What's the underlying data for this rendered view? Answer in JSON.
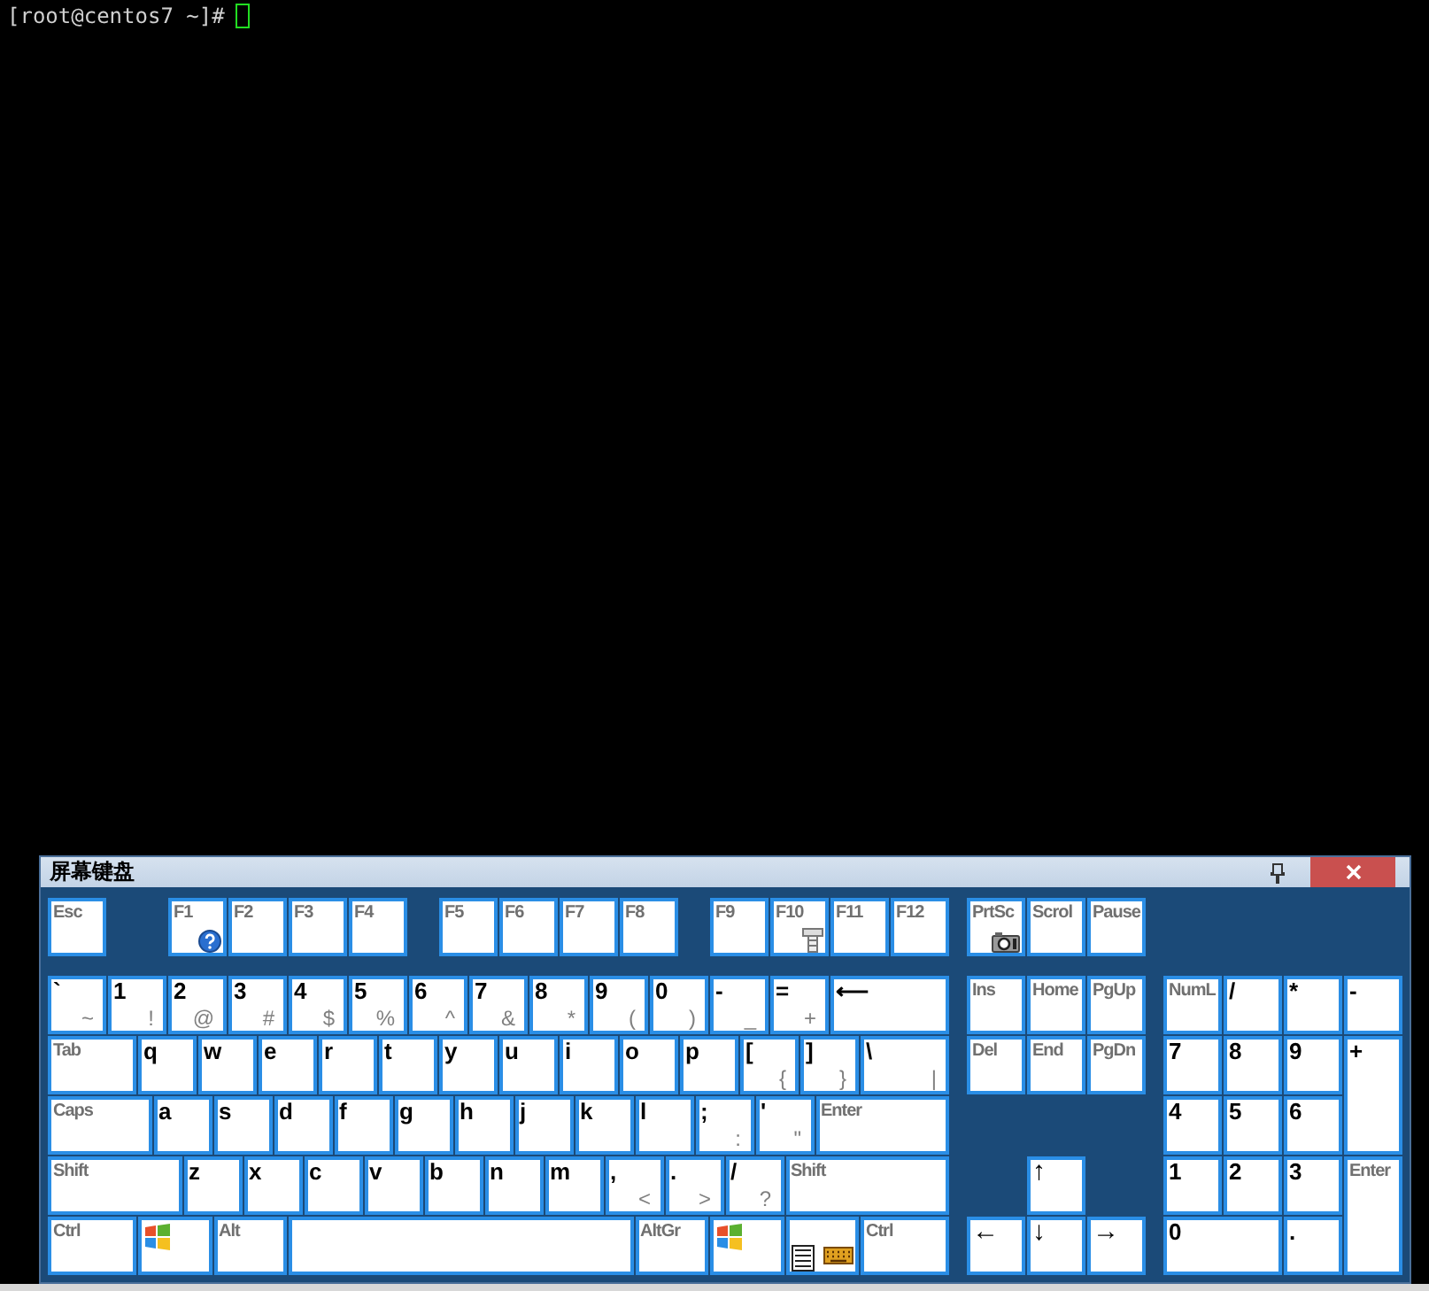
{
  "terminal": {
    "prompt": "[root@centos7 ~]#",
    "cursor_visible": true
  },
  "keyboard": {
    "title": "屏幕键盘",
    "main_keys": [
      {
        "kind": "control",
        "label": "Esc"
      },
      {
        "kind": "help",
        "label": "F1"
      },
      {
        "kind": "control",
        "label": "F2"
      },
      {
        "kind": "control",
        "label": "F3"
      },
      {
        "kind": "control",
        "label": "F4"
      },
      {
        "kind": "control",
        "label": "F5"
      },
      {
        "kind": "control",
        "label": "F6"
      },
      {
        "kind": "control",
        "label": "F7"
      },
      {
        "kind": "control",
        "label": "F8"
      },
      {
        "kind": "control",
        "label": "F9"
      },
      {
        "kind": "tool",
        "label": "F10"
      },
      {
        "kind": "control",
        "label": "F11"
      },
      {
        "kind": "control",
        "label": "F12"
      },
      {
        "kind": "char",
        "label": "`",
        "shift": "~"
      },
      {
        "kind": "char",
        "label": "1",
        "shift": "!"
      },
      {
        "kind": "char",
        "label": "2",
        "shift": "@"
      },
      {
        "kind": "char",
        "label": "3",
        "shift": "#"
      },
      {
        "kind": "char",
        "label": "4",
        "shift": "$"
      },
      {
        "kind": "char",
        "label": "5",
        "shift": "%"
      },
      {
        "kind": "char",
        "label": "6",
        "shift": "^"
      },
      {
        "kind": "char",
        "label": "7",
        "shift": "&"
      },
      {
        "kind": "char",
        "label": "8",
        "shift": "*"
      },
      {
        "kind": "char",
        "label": "9",
        "shift": "("
      },
      {
        "kind": "char",
        "label": "0",
        "shift": ")"
      },
      {
        "kind": "char",
        "label": "-",
        "shift": "_"
      },
      {
        "kind": "char",
        "label": "=",
        "shift": "+"
      },
      {
        "kind": "char",
        "label": "⟵"
      },
      {
        "kind": "control",
        "label": "Tab"
      },
      {
        "kind": "char",
        "label": "q"
      },
      {
        "kind": "char",
        "label": "w"
      },
      {
        "kind": "char",
        "label": "e"
      },
      {
        "kind": "char",
        "label": "r"
      },
      {
        "kind": "char",
        "label": "t"
      },
      {
        "kind": "char",
        "label": "y"
      },
      {
        "kind": "char",
        "label": "u"
      },
      {
        "kind": "char",
        "label": "i"
      },
      {
        "kind": "char",
        "label": "o"
      },
      {
        "kind": "char",
        "label": "p"
      },
      {
        "kind": "char",
        "label": "[",
        "shift": "{"
      },
      {
        "kind": "char",
        "label": "]",
        "shift": "}"
      },
      {
        "kind": "char",
        "label": "\\",
        "shift": "|"
      },
      {
        "kind": "control",
        "label": "Caps"
      },
      {
        "kind": "char",
        "label": "a"
      },
      {
        "kind": "char",
        "label": "s"
      },
      {
        "kind": "char",
        "label": "d"
      },
      {
        "kind": "char",
        "label": "f"
      },
      {
        "kind": "char",
        "label": "g"
      },
      {
        "kind": "char",
        "label": "h"
      },
      {
        "kind": "char",
        "label": "j"
      },
      {
        "kind": "char",
        "label": "k"
      },
      {
        "kind": "char",
        "label": "l"
      },
      {
        "kind": "char",
        "label": ";",
        "shift": ":"
      },
      {
        "kind": "char",
        "label": "'",
        "shift": "\""
      },
      {
        "kind": "control",
        "label": "Enter"
      },
      {
        "kind": "control",
        "label": "Shift"
      },
      {
        "kind": "char",
        "label": "z"
      },
      {
        "kind": "char",
        "label": "x"
      },
      {
        "kind": "char",
        "label": "c"
      },
      {
        "kind": "char",
        "label": "v"
      },
      {
        "kind": "char",
        "label": "b"
      },
      {
        "kind": "char",
        "label": "n"
      },
      {
        "kind": "char",
        "label": "m"
      },
      {
        "kind": "char",
        "label": ",",
        "shift": "<"
      },
      {
        "kind": "char",
        "label": ".",
        "shift": ">"
      },
      {
        "kind": "char",
        "label": "/",
        "shift": "?"
      },
      {
        "kind": "control",
        "label": "Shift"
      },
      {
        "kind": "control",
        "label": "Ctrl"
      },
      {
        "kind": "windows"
      },
      {
        "kind": "control",
        "label": "Alt"
      },
      {
        "kind": "space"
      },
      {
        "kind": "control",
        "label": "AltGr"
      },
      {
        "kind": "windows"
      },
      {
        "kind": "menu"
      },
      {
        "kind": "control",
        "label": "Ctrl"
      }
    ],
    "nav_keys": [
      {
        "kind": "snapshot",
        "label": "PrtSc"
      },
      {
        "kind": "control",
        "label": "Scrol"
      },
      {
        "kind": "control",
        "label": "Pause"
      },
      {
        "kind": "control",
        "label": "Ins"
      },
      {
        "kind": "control",
        "label": "Home"
      },
      {
        "kind": "control",
        "label": "PgUp"
      },
      {
        "kind": "control",
        "label": "Del"
      },
      {
        "kind": "control",
        "label": "End"
      },
      {
        "kind": "control",
        "label": "PgDn"
      },
      {
        "kind": "arrow",
        "label": "↑"
      },
      {
        "kind": "arrow",
        "label": "←"
      },
      {
        "kind": "arrow",
        "label": "↓"
      },
      {
        "kind": "arrow",
        "label": "→"
      }
    ],
    "numpad_keys": [
      {
        "kind": "control",
        "label": "NumL"
      },
      {
        "kind": "char",
        "label": "/"
      },
      {
        "kind": "char",
        "label": "*"
      },
      {
        "kind": "char",
        "label": "-"
      },
      {
        "kind": "char",
        "label": "7"
      },
      {
        "kind": "char",
        "label": "8"
      },
      {
        "kind": "char",
        "label": "9"
      },
      {
        "kind": "char",
        "label": "+"
      },
      {
        "kind": "char",
        "label": "4"
      },
      {
        "kind": "char",
        "label": "5"
      },
      {
        "kind": "char",
        "label": "6"
      },
      {
        "kind": "char",
        "label": "1"
      },
      {
        "kind": "char",
        "label": "2"
      },
      {
        "kind": "char",
        "label": "3"
      },
      {
        "kind": "control",
        "label": "Enter"
      },
      {
        "kind": "char",
        "label": "0"
      },
      {
        "kind": "char",
        "label": "."
      }
    ]
  }
}
